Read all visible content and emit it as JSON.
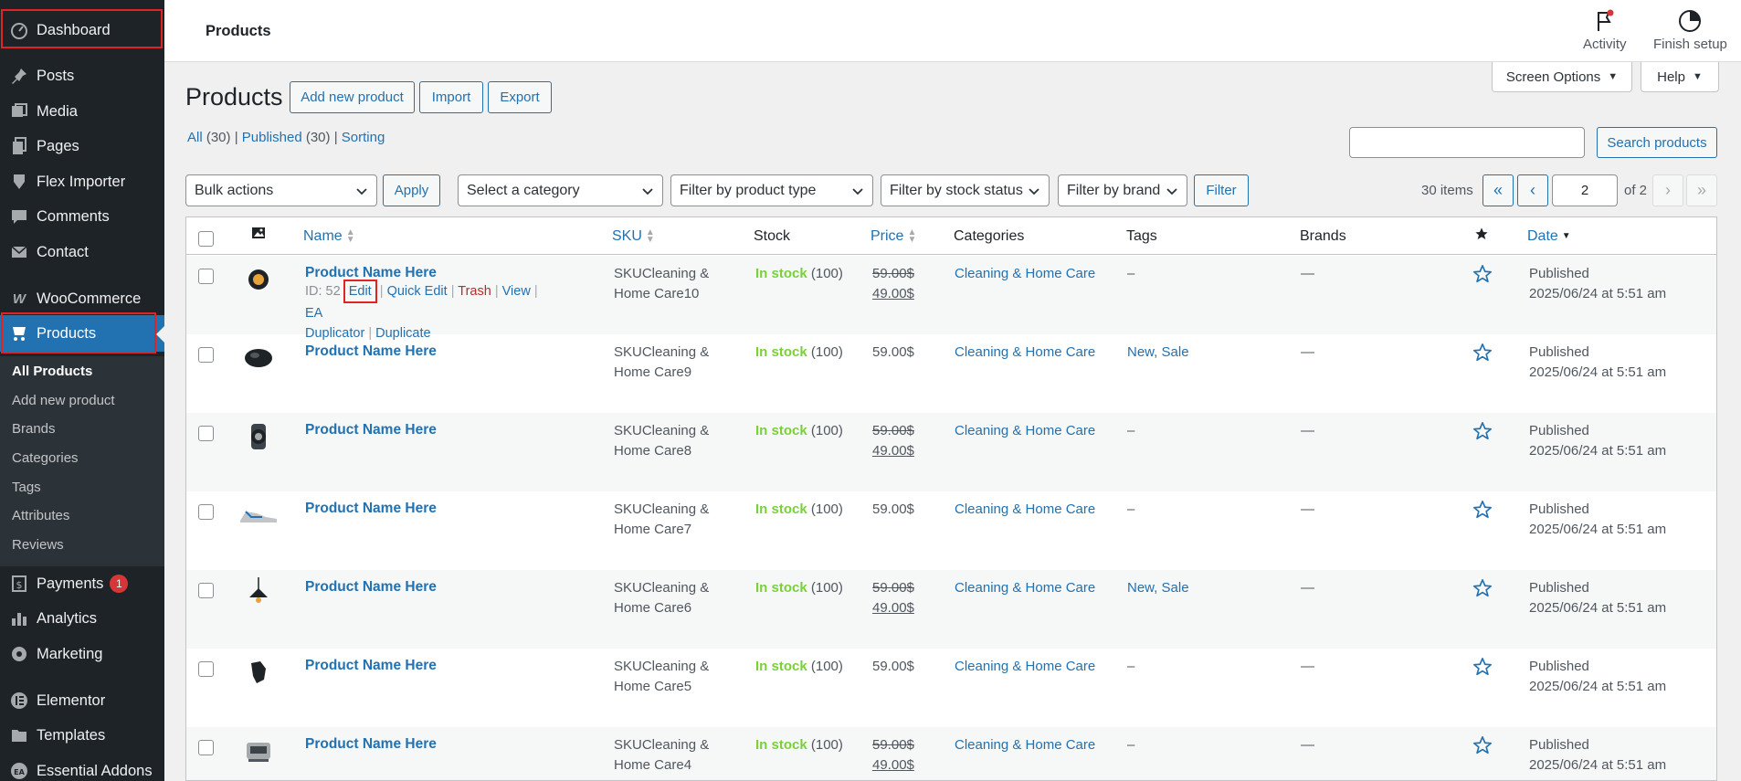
{
  "sidebar": {
    "items": [
      {
        "label": "Dashboard",
        "icon": "dashboard-icon"
      },
      {
        "label": "Posts",
        "icon": "pin-icon"
      },
      {
        "label": "Media",
        "icon": "media-icon"
      },
      {
        "label": "Pages",
        "icon": "pages-icon"
      },
      {
        "label": "Flex Importer",
        "icon": "importer-icon"
      },
      {
        "label": "Comments",
        "icon": "comment-icon"
      },
      {
        "label": "Contact",
        "icon": "mail-icon"
      },
      {
        "label": "WooCommerce",
        "icon": "woocommerce-icon"
      },
      {
        "label": "Products",
        "icon": "products-icon"
      },
      {
        "label": "Payments",
        "icon": "payments-icon",
        "badge": "1"
      },
      {
        "label": "Analytics",
        "icon": "analytics-icon"
      },
      {
        "label": "Marketing",
        "icon": "marketing-icon"
      },
      {
        "label": "Elementor",
        "icon": "elementor-icon"
      },
      {
        "label": "Templates",
        "icon": "folder-icon"
      },
      {
        "label": "Essential Addons",
        "icon": "ea-icon"
      }
    ],
    "submenu": [
      "All Products",
      "Add new product",
      "Brands",
      "Categories",
      "Tags",
      "Attributes",
      "Reviews"
    ]
  },
  "topbar": {
    "title": "Products",
    "activity": "Activity",
    "finish_setup": "Finish setup"
  },
  "screen_options": "Screen Options",
  "help": "Help",
  "page": {
    "title": "Products",
    "add_new": "Add new product",
    "import": "Import",
    "export": "Export"
  },
  "subsub": {
    "all": "All",
    "all_count": "(30)",
    "published": "Published",
    "published_count": "(30)",
    "sorting": "Sorting"
  },
  "search": {
    "button": "Search products",
    "value": ""
  },
  "filters": {
    "bulk": "Bulk actions",
    "apply": "Apply",
    "category": "Select a category",
    "product_type": "Filter by product type",
    "stock_status": "Filter by stock status",
    "brand": "Filter by brand",
    "filter": "Filter"
  },
  "pagination": {
    "items": "30 items",
    "current": "2",
    "of": "of 2",
    "first": "«",
    "prev": "‹",
    "next": "›",
    "last": "»"
  },
  "columns": {
    "name": "Name",
    "sku": "SKU",
    "stock": "Stock",
    "price": "Price",
    "categories": "Categories",
    "tags": "Tags",
    "brands": "Brands",
    "date": "Date"
  },
  "rows": [
    {
      "name": "Product Name Here",
      "sku1": "SKUCleaning &",
      "sku2": "Home Care10",
      "stock_label": "In stock",
      "stock_qty": "(100)",
      "price": "59.00$",
      "sale": "49.00$",
      "category": "Cleaning & Home Care",
      "tags": "–",
      "brands": "—",
      "date_status": "Published",
      "date": "2025/06/24 at 5:51 am",
      "thumb": "watch-icon",
      "actions": {
        "id": "ID: 52",
        "edit": "Edit",
        "quick_edit": "Quick Edit",
        "trash": "Trash",
        "view": "View",
        "ea": "EA",
        "duplicator": "Duplicator",
        "duplicate": "Duplicate"
      }
    },
    {
      "name": "Product Name Here",
      "sku1": "SKUCleaning &",
      "sku2": "Home Care9",
      "stock_label": "In stock",
      "stock_qty": "(100)",
      "price": "59.00$",
      "sale": "",
      "category": "Cleaning & Home Care",
      "tags": "New, Sale",
      "brands": "—",
      "date_status": "Published",
      "date": "2025/06/24 at 5:51 am",
      "thumb": "mouse-icon"
    },
    {
      "name": "Product Name Here",
      "sku1": "SKUCleaning &",
      "sku2": "Home Care8",
      "stock_label": "In stock",
      "stock_qty": "(100)",
      "price": "59.00$",
      "sale": "49.00$",
      "category": "Cleaning & Home Care",
      "tags": "–",
      "brands": "—",
      "date_status": "Published",
      "date": "2025/06/24 at 5:51 am",
      "thumb": "smartwatch-icon"
    },
    {
      "name": "Product Name Here",
      "sku1": "SKUCleaning &",
      "sku2": "Home Care7",
      "stock_label": "In stock",
      "stock_qty": "(100)",
      "price": "59.00$",
      "sale": "",
      "category": "Cleaning & Home Care",
      "tags": "–",
      "brands": "—",
      "date_status": "Published",
      "date": "2025/06/24 at 5:51 am",
      "thumb": "sneaker-icon"
    },
    {
      "name": "Product Name Here",
      "sku1": "SKUCleaning &",
      "sku2": "Home Care6",
      "stock_label": "In stock",
      "stock_qty": "(100)",
      "price": "59.00$",
      "sale": "49.00$",
      "category": "Cleaning & Home Care",
      "tags": "New, Sale",
      "brands": "—",
      "date_status": "Published",
      "date": "2025/06/24 at 5:51 am",
      "thumb": "lamp-icon"
    },
    {
      "name": "Product Name Here",
      "sku1": "SKUCleaning &",
      "sku2": "Home Care5",
      "stock_label": "In stock",
      "stock_qty": "(100)",
      "price": "59.00$",
      "sale": "",
      "category": "Cleaning & Home Care",
      "tags": "–",
      "brands": "—",
      "date_status": "Published",
      "date": "2025/06/24 at 5:51 am",
      "thumb": "glove-icon"
    },
    {
      "name": "Product Name Here",
      "sku1": "SKUCleaning &",
      "sku2": "Home Care4",
      "stock_label": "In stock",
      "stock_qty": "(100)",
      "price": "59.00$",
      "sale": "49.00$",
      "category": "Cleaning & Home Care",
      "tags": "–",
      "brands": "—",
      "date_status": "Published",
      "date": "2025/06/24 at 5:51 am",
      "thumb": "speaker-icon"
    }
  ]
}
